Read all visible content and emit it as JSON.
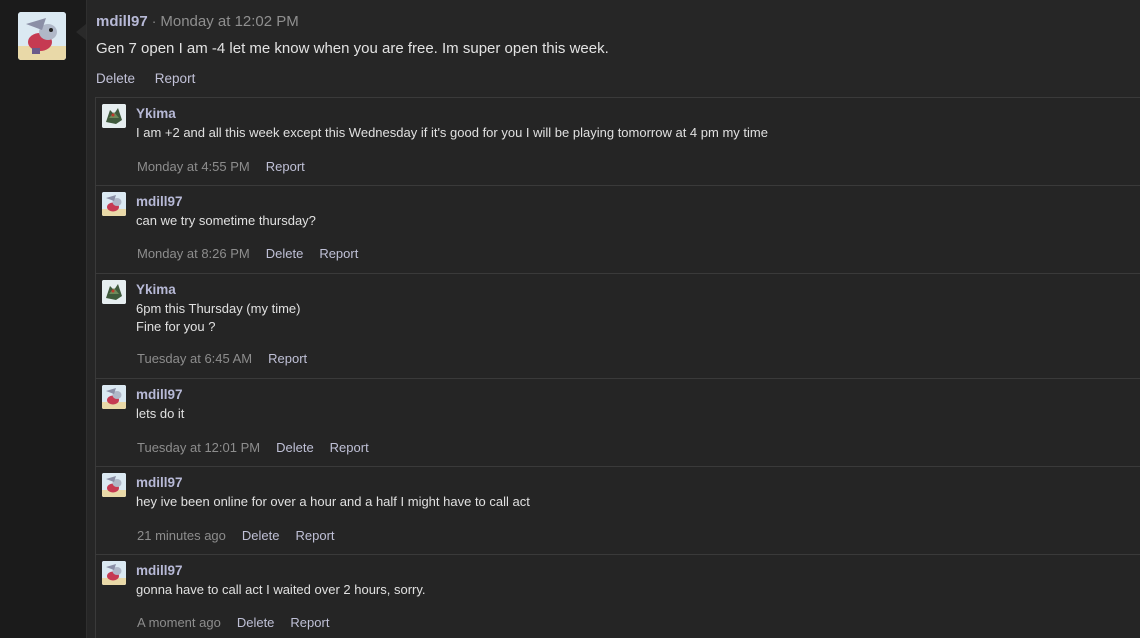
{
  "post": {
    "author": "mdill97",
    "separator": "·",
    "time": "Monday at 12:02 PM",
    "text": "Gen 7 open I am -4 let me know when you are free. Im super open this week.",
    "actions": [
      "Delete",
      "Report"
    ]
  },
  "comments": [
    {
      "author": "Ykima",
      "avatar": "ykima-avatar",
      "lines": [
        "I am +2 and all this week except this Wednesday if it's good for you I will be playing tomorrow at 4 pm my time"
      ],
      "time": "Monday at 4:55 PM",
      "actions": [
        "Report"
      ]
    },
    {
      "author": "mdill97",
      "avatar": "mdill97-avatar",
      "lines": [
        "can we try sometime thursday?"
      ],
      "time": "Monday at 8:26 PM",
      "actions": [
        "Delete",
        "Report"
      ]
    },
    {
      "author": "Ykima",
      "avatar": "ykima-avatar",
      "lines": [
        "6pm this Thursday (my time)",
        "Fine for you ?"
      ],
      "time": "Tuesday at 6:45 AM",
      "actions": [
        "Report"
      ]
    },
    {
      "author": "mdill97",
      "avatar": "mdill97-avatar",
      "lines": [
        "lets do it"
      ],
      "time": "Tuesday at 12:01 PM",
      "actions": [
        "Delete",
        "Report"
      ]
    },
    {
      "author": "mdill97",
      "avatar": "mdill97-avatar",
      "lines": [
        "hey ive been online for over a hour and a half I might have to call act"
      ],
      "time": "21 minutes ago",
      "actions": [
        "Delete",
        "Report"
      ]
    },
    {
      "author": "mdill97",
      "avatar": "mdill97-avatar",
      "lines": [
        "gonna have to call act I waited over 2 hours, sorry."
      ],
      "time": "A moment ago",
      "actions": [
        "Delete",
        "Report"
      ]
    }
  ]
}
